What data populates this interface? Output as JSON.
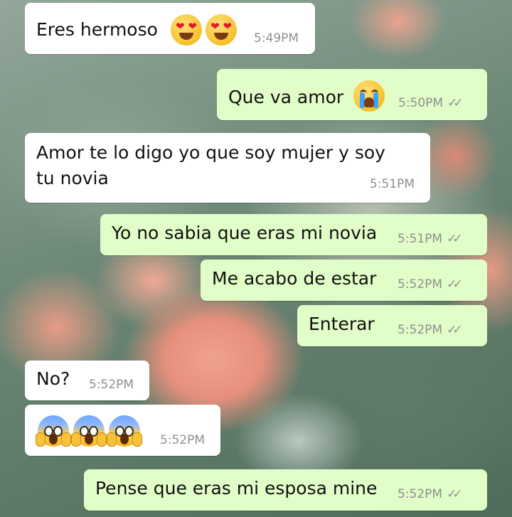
{
  "chat": {
    "messages": [
      {
        "direction": "in",
        "text": "Eres hermoso",
        "time": "5:49PM",
        "emoji": [
          "heart-eyes",
          "heart-eyes"
        ]
      },
      {
        "direction": "out",
        "text": "Que va amor",
        "time": "5:50PM",
        "emoji": [
          "crying"
        ],
        "status": "read"
      },
      {
        "direction": "in",
        "text_line1": "Amor te lo digo yo que soy mujer y soy",
        "text_line2": "tu novia",
        "time": "5:51PM"
      },
      {
        "direction": "out",
        "text": "Yo no sabia que eras mi novia",
        "time": "5:51PM",
        "status": "read"
      },
      {
        "direction": "out",
        "text": "Me acabo de estar",
        "time": "5:52PM",
        "status": "read"
      },
      {
        "direction": "out",
        "text": "Enterar",
        "time": "5:52PM",
        "status": "read"
      },
      {
        "direction": "in",
        "text": "No?",
        "time": "5:52PM"
      },
      {
        "direction": "in",
        "text": "",
        "time": "5:52PM",
        "emoji": [
          "scream",
          "scream",
          "scream"
        ]
      },
      {
        "direction": "out",
        "text": "Pense que eras mi esposa mine",
        "time": "5:52PM",
        "status": "read"
      }
    ],
    "ticks": "✓✓",
    "colors": {
      "incoming": "#ffffff",
      "outgoing": "#e1fec8",
      "time": "#8f8f8f"
    }
  }
}
